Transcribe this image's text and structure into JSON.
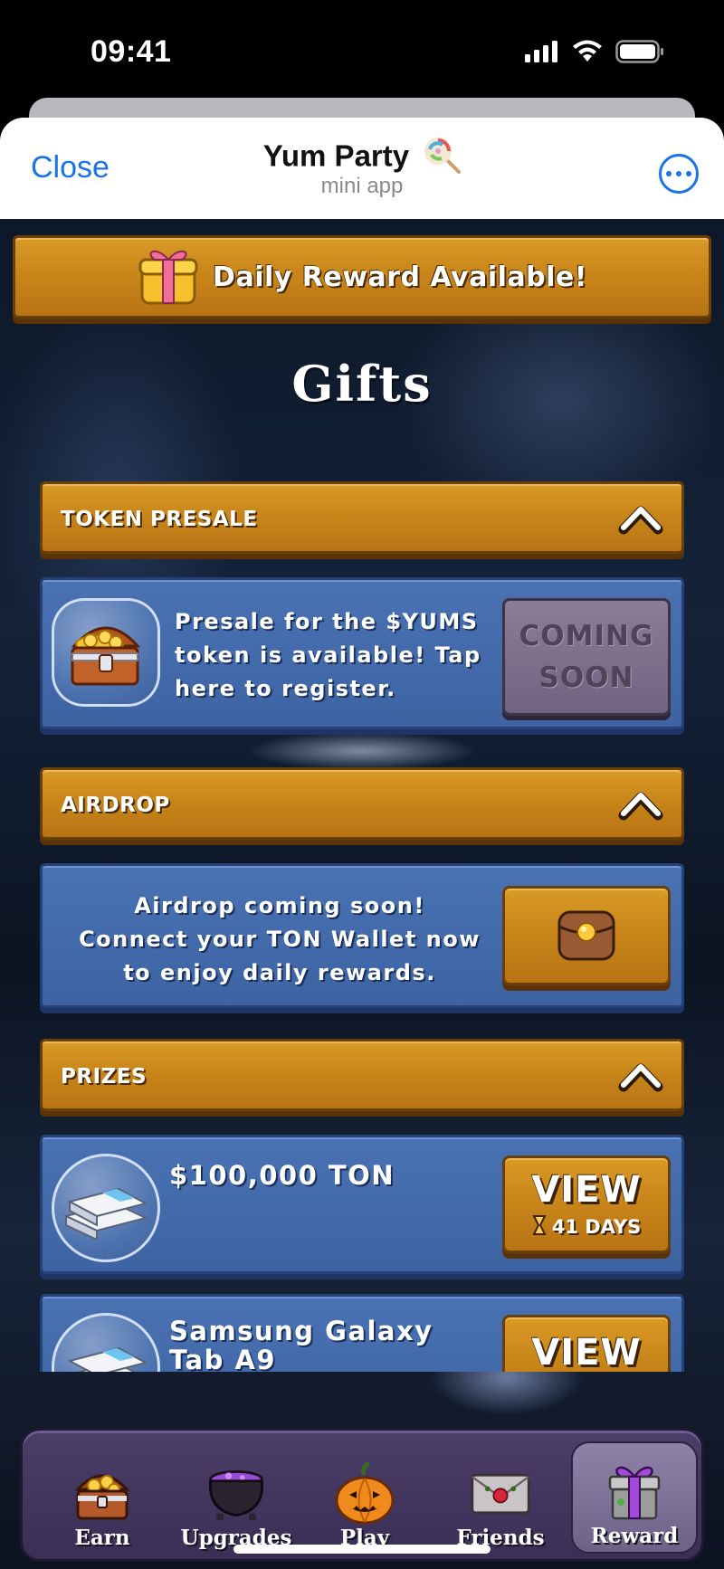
{
  "status_bar": {
    "time": "09:41"
  },
  "header": {
    "close_label": "Close",
    "title": "Yum Party",
    "subtitle": "mini app"
  },
  "daily_banner": {
    "label": "Daily Reward Available!"
  },
  "page_title": "Gifts",
  "sections": {
    "presale": {
      "title": "TOKEN PRESALE",
      "description": "Presale for the $YUMS token is available! Tap here to register.",
      "line1": "Presale for the $YUMS",
      "line2": "token is available! Tap",
      "line3": "here to register.",
      "button_line1": "COMING",
      "button_line2": "SOON"
    },
    "airdrop": {
      "title": "AIRDROP",
      "line1": "Airdrop coming soon!",
      "line2": "Connect your TON Wallet now",
      "line3": "to enjoy daily rewards."
    },
    "prizes": {
      "title": "PRIZES",
      "items": [
        {
          "title": "$100,000 TON",
          "button": "VIEW",
          "time_left": "41 DAYS"
        },
        {
          "title_line1": "Samsung Galaxy",
          "title_line2": "Tab A9",
          "button": "VIEW"
        }
      ]
    }
  },
  "nav": {
    "items": [
      {
        "label": "Earn",
        "icon": "treasure-chest-icon"
      },
      {
        "label": "Upgrades",
        "icon": "cauldron-icon"
      },
      {
        "label": "Play",
        "icon": "pumpkin-icon"
      },
      {
        "label": "Friends",
        "icon": "envelope-icon"
      },
      {
        "label": "Reward",
        "icon": "gift-box-icon"
      }
    ],
    "active": "Reward"
  },
  "colors": {
    "wood": "#c9861a",
    "panel_blue": "#4169a9",
    "nav_purple": "#44385f",
    "link_blue": "#1a73e8"
  }
}
